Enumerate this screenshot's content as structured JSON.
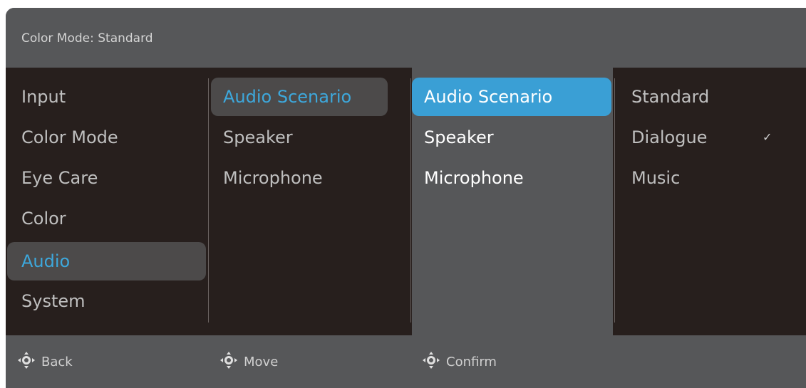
{
  "header": {
    "title": "Color Mode: Standard"
  },
  "menu_main": [
    "Input",
    "Color Mode",
    "Eye Care",
    "Color",
    "Audio",
    "System"
  ],
  "menu_audio": [
    "Audio Scenario",
    "Speaker",
    "Microphone"
  ],
  "menu_audio_focus": [
    "Audio Scenario",
    "Speaker",
    "Microphone"
  ],
  "menu_scenario": [
    "Standard",
    "Dialogue",
    "Music"
  ],
  "scenario_check": "✓",
  "footer": {
    "back": "Back",
    "move": "Move",
    "confirm": "Confirm"
  },
  "colors": {
    "accent": "#3a9fd5",
    "accent_text": "#3da8dc",
    "panel": "#565759",
    "body": "#271f1d"
  },
  "icons": {
    "nav": "joystick-icon",
    "check": "checkmark-icon"
  }
}
